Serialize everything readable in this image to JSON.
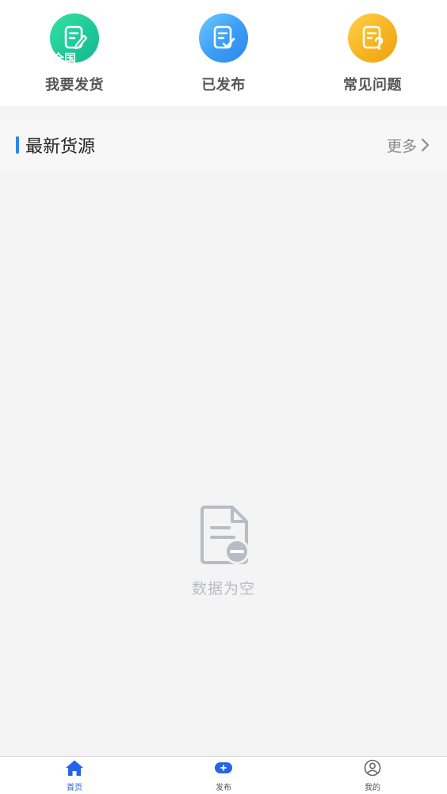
{
  "quick_actions": [
    {
      "label": "我要发货",
      "corner_text": "全国",
      "icon": "edit-document-icon",
      "color": "#1fc99a"
    },
    {
      "label": "已发布",
      "icon": "checked-document-icon",
      "color": "#3a9df5"
    },
    {
      "label": "常见问题",
      "icon": "question-document-icon",
      "color": "#f7b422"
    }
  ],
  "section": {
    "title": "最新货源",
    "more_label": "更多",
    "accent": "#2f86ea"
  },
  "empty_state": {
    "text": "数据为空",
    "icon": "empty-document-icon"
  },
  "bottom_nav": {
    "items": [
      {
        "label": "首页",
        "icon": "home-icon",
        "active": true
      },
      {
        "label": "发布",
        "icon": "publish-icon",
        "active": false
      },
      {
        "label": "我的",
        "icon": "profile-icon",
        "active": false
      }
    ],
    "active_color": "#2563eb"
  }
}
